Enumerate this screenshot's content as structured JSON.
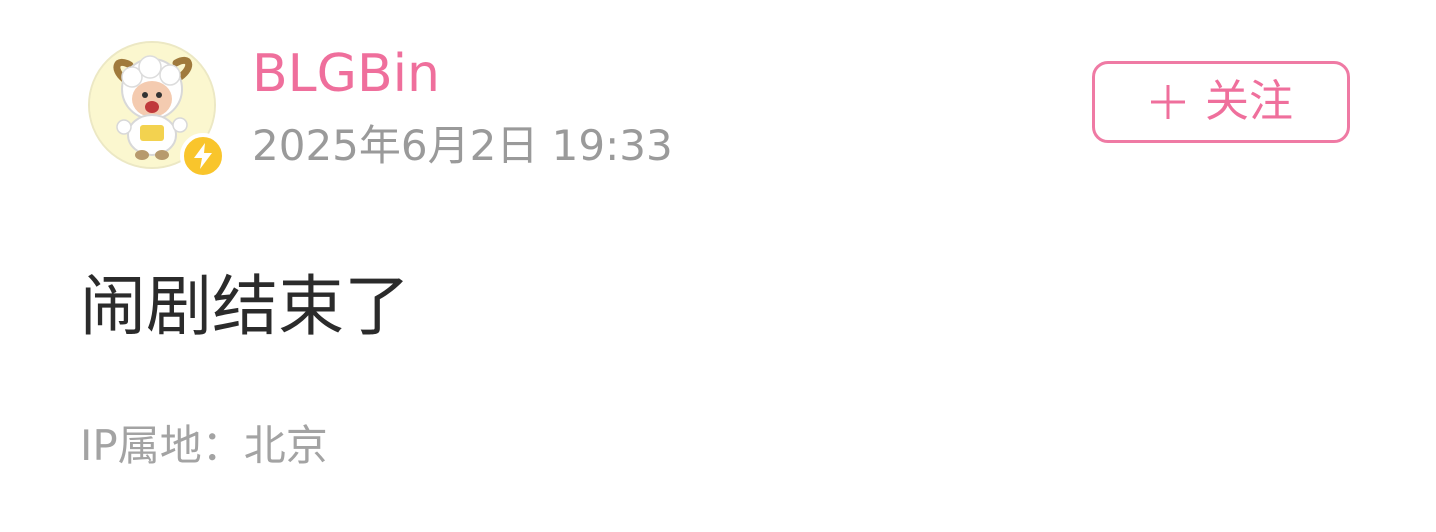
{
  "post": {
    "author": {
      "username": "BLGBin",
      "avatar_icon": "sheep-cartoon-avatar",
      "badge_icon": "lightning-icon",
      "badge_color": "#f9c52c"
    },
    "timestamp": "2025年6月2日 19:33",
    "follow_button": {
      "icon": "plus-icon",
      "label": "关注"
    },
    "content": "闹剧结束了",
    "ip_location": "IP属地：北京"
  },
  "colors": {
    "accent_pink": "#ef6f9c",
    "text_primary": "#2b2b2b",
    "text_secondary": "#9a9a9a",
    "background": "#ffffff"
  }
}
